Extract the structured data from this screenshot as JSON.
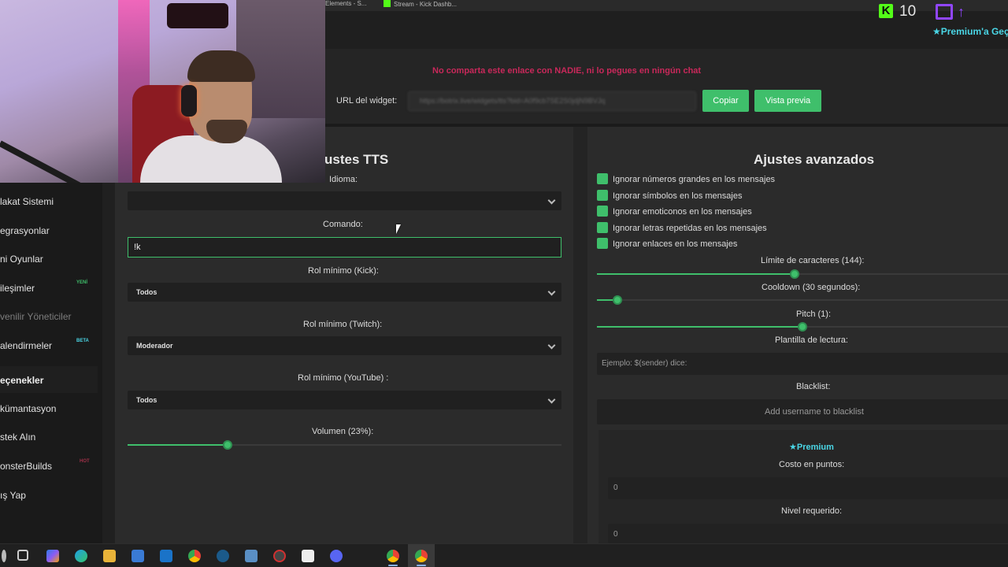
{
  "browser": {
    "tab1": "Elements - S...",
    "tab2": "Stream - Kick Dashb..."
  },
  "topright": {
    "kick_letter": "K",
    "kick_count": "10",
    "premium_label": "★Premium'a Geç"
  },
  "widget": {
    "warning": "No comparta este enlace con NADIE, ni lo pegues en ningún chat",
    "url_label": "URL del widget:",
    "url_value": "https://botrix.live/widgets/tts?bid=A0f9cb7SE2S0jdjN9BVJq",
    "copy_button": "Copiar",
    "preview_button": "Vista previa"
  },
  "sidebar": {
    "items": [
      {
        "label": "lakat Sistemi"
      },
      {
        "label": "egrasyonlar"
      },
      {
        "label": "ni Oyunlar"
      },
      {
        "label": "ileşimler",
        "badge": "YENİ"
      },
      {
        "label": "venilir Yöneticiler"
      },
      {
        "label": "alendirmeler",
        "badge": "BETA"
      },
      {
        "label": "eçenekler"
      },
      {
        "label": "kümantasyon"
      },
      {
        "label": "stek Alın"
      },
      {
        "label": "onsterBuilds",
        "badge": "HOT"
      },
      {
        "label": "ış Yap"
      }
    ]
  },
  "tts": {
    "title": "ustes TTS",
    "language_label": "Idioma:",
    "language_value": "",
    "command_label": "Comando:",
    "command_value": "!k",
    "role_kick_label": "Rol mínimo (Kick):",
    "role_kick_value": "Todos",
    "role_twitch_label": "Rol mínimo (Twitch):",
    "role_twitch_value": "Moderador",
    "role_youtube_label": "Rol mínimo (YouTube) :",
    "role_youtube_value": "Todos",
    "volume_label": "Volumen (23%):",
    "volume_percent": 23
  },
  "advanced": {
    "title": "Ajustes avanzados",
    "checks": [
      "Ignorar números grandes en los mensajes",
      "Ignorar símbolos en los mensajes",
      "Ignorar emoticonos en los mensajes",
      "Ignorar letras repetidas en los mensajes",
      "Ignorar enlaces en los mensajes"
    ],
    "char_limit_label": "Límite de caracteres (144):",
    "char_limit_fraction": 0.48,
    "cooldown_label": "Cooldown (30 segundos):",
    "cooldown_fraction": 0.05,
    "pitch_label": "Pitch (1):",
    "pitch_fraction": 0.5,
    "template_label": "Plantilla de lectura:",
    "template_placeholder": "Ejemplo: $(sender) dice:",
    "blacklist_label": "Blacklist:",
    "blacklist_button": "Add username to blacklist",
    "premium_label": "★Premium",
    "points_label": "Costo en puntos:",
    "points_value": "0",
    "level_label": "Nivel requerido:",
    "level_value": "0"
  },
  "colors": {
    "accent": "#3fbf6b",
    "warning": "#c8285a",
    "premium": "#4ad6e6",
    "kick": "#53fc18",
    "twitch": "#9146ff"
  }
}
